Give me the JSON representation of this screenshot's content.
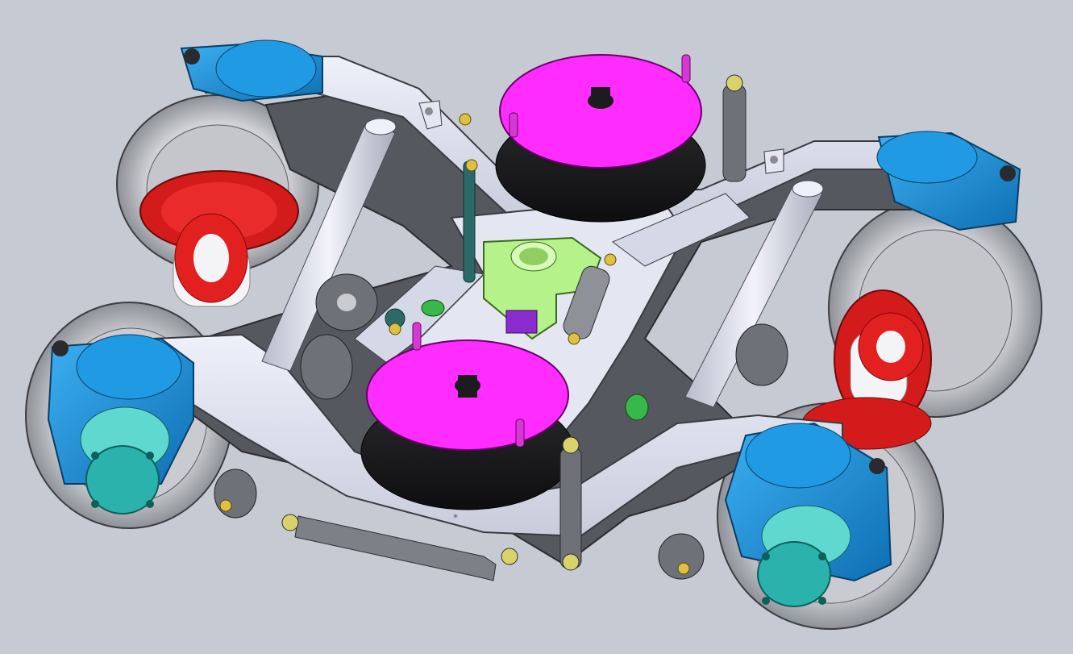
{
  "viewport": {
    "background": "#c6cbd3",
    "origin_marker": "*"
  },
  "colors": {
    "frame": "#dfe2ef",
    "frame_dark": "#56595f",
    "air_spring_top": "#ff2cff",
    "air_spring_bellow": "#1c1c1e",
    "axlebox": "#1b8fd8",
    "axlebox_cover": "#2bb2ac",
    "brake_disc": "#e31a1a",
    "wheel": "#d6d8de",
    "axle": "#f4f4f7",
    "center_pivot": "#b6f28a",
    "traction_rod": "#6f7277"
  },
  "components": [
    {
      "name": "bogie-frame-icon"
    },
    {
      "name": "air-spring-rear-icon"
    },
    {
      "name": "air-spring-front-icon"
    },
    {
      "name": "wheelset-left-icon"
    },
    {
      "name": "wheelset-right-icon"
    },
    {
      "name": "axlebox-icon"
    },
    {
      "name": "brake-disc-icon"
    },
    {
      "name": "center-pivot-icon"
    },
    {
      "name": "damper-icon"
    },
    {
      "name": "traction-rod-icon"
    }
  ]
}
